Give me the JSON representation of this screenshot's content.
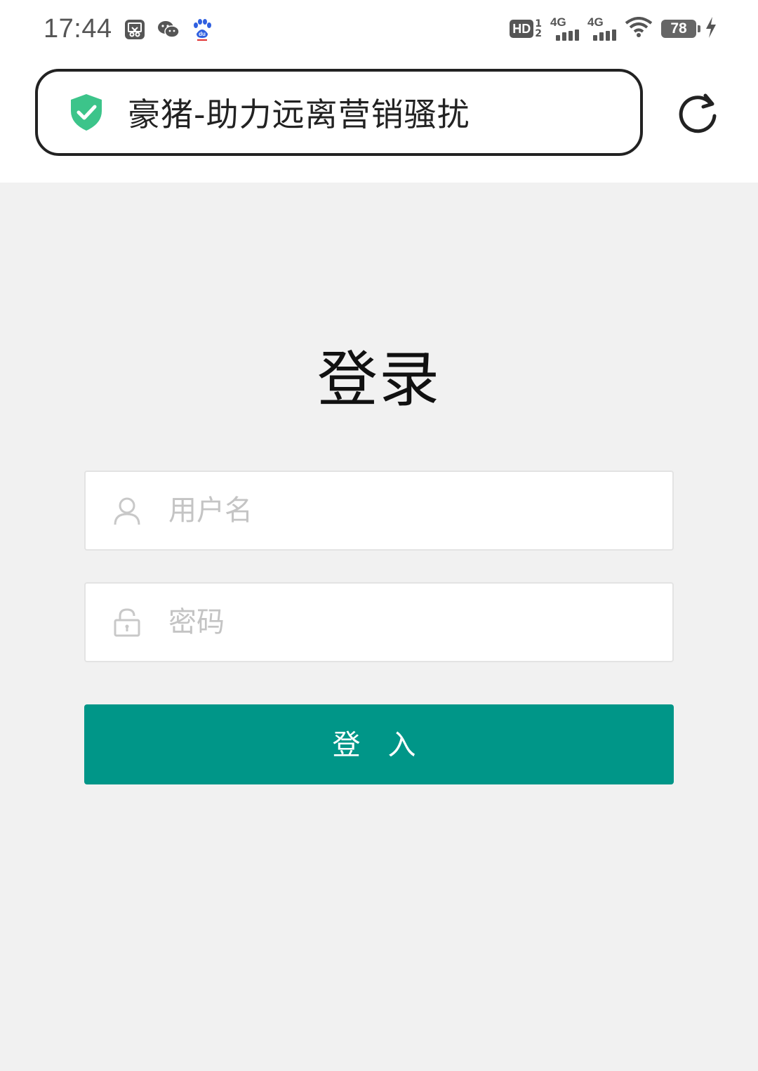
{
  "status_bar": {
    "time": "17:44",
    "app_icons": [
      "screenshot-icon",
      "wechat-icon",
      "baidu-icon"
    ],
    "hd_label": "HD",
    "hd_sub_top": "1",
    "hd_sub_bottom": "2",
    "network_1": "4G",
    "network_2": "4G",
    "battery": "78"
  },
  "browser": {
    "page_title": "豪猪-助力远离营销骚扰",
    "secure_icon": "shield-check-icon",
    "reload_icon": "reload-icon",
    "accent_color": "#3cc48a"
  },
  "login": {
    "title": "登录",
    "username_placeholder": "用户名",
    "password_placeholder": "密码",
    "submit_label": "登 入",
    "button_color": "#009688"
  }
}
